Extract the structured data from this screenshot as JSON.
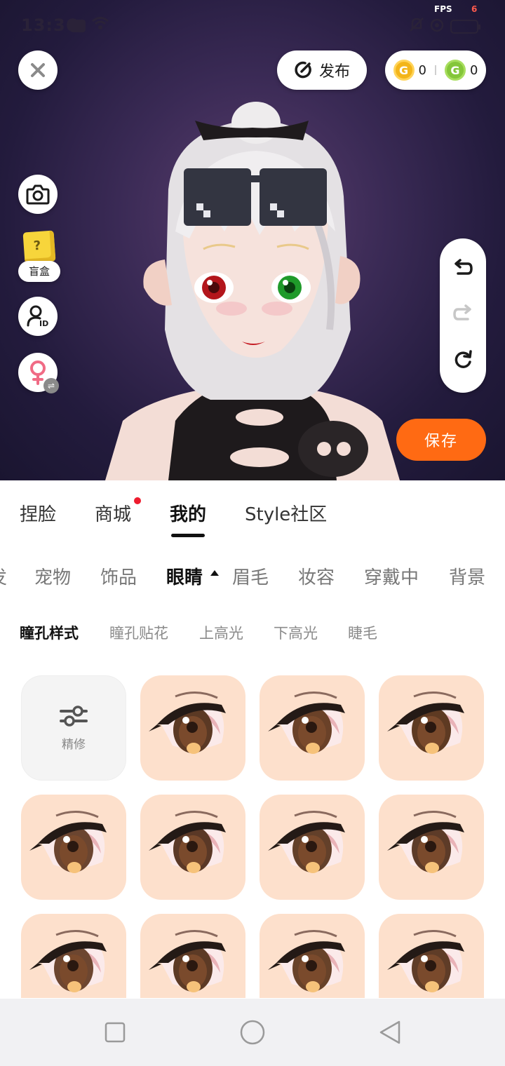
{
  "status_bar": {
    "time": "13:36",
    "fps_label": "FPS",
    "fps_value": "6"
  },
  "top_bar": {
    "close_icon": "close-icon",
    "publish_label": "发布",
    "coins": [
      {
        "name": "gold-coin-icon",
        "value": "0"
      },
      {
        "name": "green-coin-icon",
        "value": "0"
      }
    ]
  },
  "left_tools": {
    "camera_icon": "camera-icon",
    "blind_box_label": "盲盒",
    "id_icon": "user-id-icon",
    "gender_icon": "female-icon"
  },
  "history_tools": [
    "undo-icon",
    "redo-icon",
    "reset-icon"
  ],
  "save_label": "保存",
  "main_tabs": [
    {
      "label": "捏脸",
      "active": false
    },
    {
      "label": "商城",
      "active": false,
      "badge": true
    },
    {
      "label": "我的",
      "active": true
    },
    {
      "label": "Style社区",
      "active": false
    }
  ],
  "categories": [
    {
      "label": "发",
      "active": false
    },
    {
      "label": "宠物",
      "active": false
    },
    {
      "label": "饰品",
      "active": false
    },
    {
      "label": "眼睛",
      "active": true
    },
    {
      "label": "眉毛",
      "active": false
    },
    {
      "label": "妆容",
      "active": false
    },
    {
      "label": "穿戴中",
      "active": false
    },
    {
      "label": "背景",
      "active": false
    }
  ],
  "sub_tabs": [
    {
      "label": "瞳孔样式",
      "active": true
    },
    {
      "label": "瞳孔贴花",
      "active": false
    },
    {
      "label": "上高光",
      "active": false
    },
    {
      "label": "下高光",
      "active": false
    },
    {
      "label": "睫毛",
      "active": false
    }
  ],
  "grid": {
    "edit_label": "精修",
    "item_count": 11
  },
  "colors": {
    "accent": "#ff6a13",
    "badge": "#ee1c2e",
    "tile_background": "#fde0cc",
    "background_dark": "#231b3d"
  }
}
